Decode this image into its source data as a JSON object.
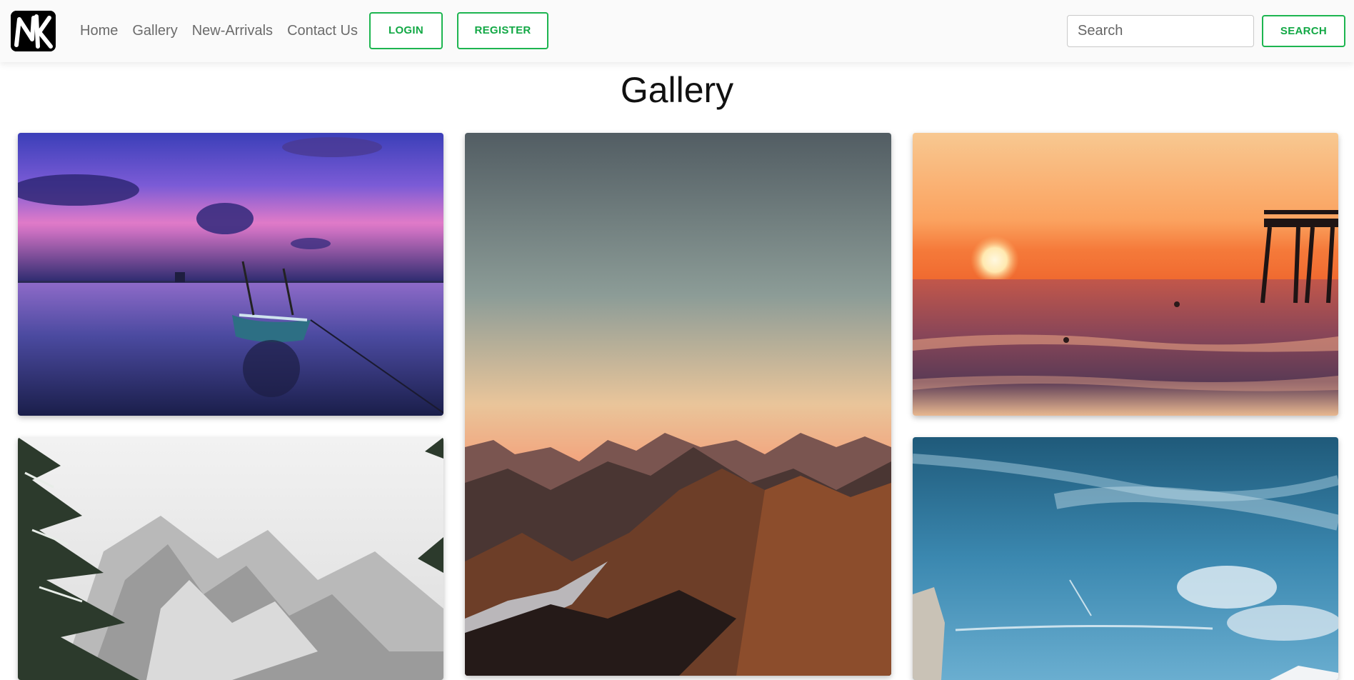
{
  "brand": {
    "logo_icon": "nk-logo-icon"
  },
  "nav": {
    "links": [
      "Home",
      "Gallery",
      "New-Arrivals",
      "Contact Us"
    ],
    "login_label": "LOGIN",
    "register_label": "REGISTER"
  },
  "search": {
    "placeholder": "Search",
    "button_label": "SEARCH"
  },
  "page": {
    "title": "Gallery"
  },
  "colors": {
    "accent": "#1db550",
    "navbar_bg": "#fafafa",
    "title": "#111111"
  },
  "gallery": {
    "images": [
      {
        "icon": "sunset-lake-boat-image"
      },
      {
        "icon": "mountain-dusk-image"
      },
      {
        "icon": "beach-sunset-pier-image"
      },
      {
        "icon": "snowy-mountain-trees-image"
      },
      {
        "icon": "blue-sky-cliff-image"
      }
    ]
  }
}
